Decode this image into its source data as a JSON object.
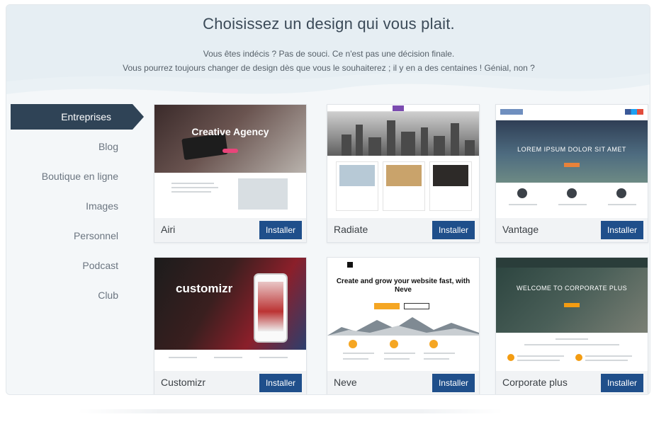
{
  "header": {
    "title": "Choisissez un design qui vous plait.",
    "subtitle_line1": "Vous êtes indécis ? Pas de souci. Ce n'est pas une décision finale.",
    "subtitle_line2": "Vous pourrez toujours changer de design dès que vous le souhaiterez ; il y en a des centaines ! Génial, non ?"
  },
  "sidebar": {
    "items": [
      {
        "label": "Entreprises",
        "active": true
      },
      {
        "label": "Blog",
        "active": false
      },
      {
        "label": "Boutique en ligne",
        "active": false
      },
      {
        "label": "Images",
        "active": false
      },
      {
        "label": "Personnel",
        "active": false
      },
      {
        "label": "Podcast",
        "active": false
      },
      {
        "label": "Club",
        "active": false
      }
    ]
  },
  "themes": [
    {
      "name": "Airi",
      "install_label": "Installer",
      "preview_text": "Creative Agency"
    },
    {
      "name": "Radiate",
      "install_label": "Installer",
      "preview_text": ""
    },
    {
      "name": "Vantage",
      "install_label": "Installer",
      "preview_text": "LOREM IPSUM DOLOR SIT AMET"
    },
    {
      "name": "Customizr",
      "install_label": "Installer",
      "preview_text": "customizr"
    },
    {
      "name": "Neve",
      "install_label": "Installer",
      "preview_text": "Create and grow your website fast, with Neve"
    },
    {
      "name": "Corporate plus",
      "install_label": "Installer",
      "preview_text": "WELCOME TO CORPORATE PLUS"
    }
  ],
  "colors": {
    "sidebar_active": "#2f4356",
    "install_button": "#1f4f8b",
    "panel_bg": "#f4f7f9"
  }
}
